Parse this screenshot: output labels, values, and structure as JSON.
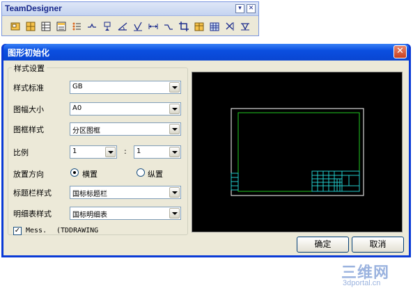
{
  "toolbar": {
    "title": "TeamDesigner",
    "minimize_glyph": "▾",
    "close_glyph": "✕",
    "icons": [
      "frame-icon",
      "grid-icon",
      "table-icon",
      "list-icon",
      "bullet-list-icon",
      "weld-symbol-icon",
      "datum-icon",
      "angle-icon",
      "surface-finish-icon",
      "dimension-icon",
      "leader-icon",
      "crop-icon",
      "block-icon",
      "table-grid-icon",
      "cut-icon",
      "tolerance-icon"
    ]
  },
  "dialog": {
    "title": "图形初始化",
    "close_glyph": "✕",
    "group_title": "样式设置",
    "fields": {
      "style_standard": {
        "label": "样式标准",
        "value": "GB"
      },
      "paper_size": {
        "label": "图幅大小",
        "value": "A0"
      },
      "frame_style": {
        "label": "图框样式",
        "value": "分区图框"
      },
      "scale": {
        "label": "比例",
        "left": "1",
        "separator": ":",
        "right": "1"
      },
      "orientation": {
        "label": "放置方向",
        "option_landscape": "横置",
        "option_portrait": "纵置",
        "selected": "横置"
      },
      "title_block": {
        "label": "标题栏样式",
        "value": "国标标题栏"
      },
      "parts_list": {
        "label": "明细表样式",
        "value": "国标明细表"
      }
    },
    "checkbox": {
      "label": "Mess.",
      "suffix": "(TDDRAWING",
      "checked": true,
      "check_glyph": "✓"
    },
    "ok_label": "确定",
    "cancel_label": "取消"
  },
  "watermark": {
    "brand": "三维网",
    "url": "3dportal.cn"
  },
  "colors": {
    "preview_bg": "#000000",
    "sheet_border": "#ffffff",
    "frame_border": "#22cc22",
    "title_block_lines": "#22cccc",
    "dialog_blue": "#0a46d2"
  }
}
